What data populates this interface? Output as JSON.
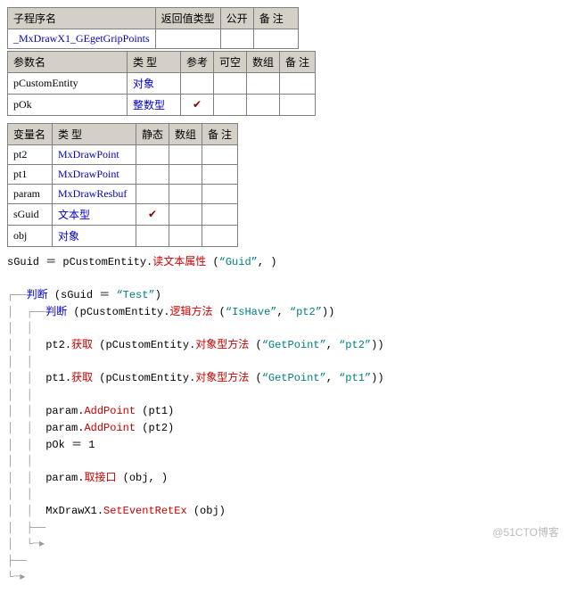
{
  "sub_table": {
    "headers": [
      "子程序名",
      "返回值类型",
      "公开",
      "备 注"
    ],
    "row": {
      "name": "_MxDrawX1_GEgetGripPoints"
    }
  },
  "param_table": {
    "headers": [
      "参数名",
      "类 型",
      "参考",
      "可空",
      "数组",
      "备 注"
    ],
    "rows": [
      {
        "name": "pCustomEntity",
        "type": "对象",
        "ref": ""
      },
      {
        "name": "pOk",
        "type": "整数型",
        "ref": "✔"
      }
    ]
  },
  "var_table": {
    "headers": [
      "变量名",
      "类 型",
      "静态",
      "数组",
      "备 注"
    ],
    "rows": [
      {
        "name": "pt2",
        "type": "MxDrawPoint",
        "static": ""
      },
      {
        "name": "pt1",
        "type": "MxDrawPoint",
        "static": ""
      },
      {
        "name": "param",
        "type": "MxDrawResbuf",
        "static": ""
      },
      {
        "name": "sGuid",
        "type": "文本型",
        "static": "✔"
      },
      {
        "name": "obj",
        "type": "对象",
        "static": ""
      }
    ]
  },
  "code": {
    "l1a": "sGuid ＝ pCustomEntity.",
    "l1b": "读文本属性",
    "l1c": " (",
    "l1d": "“Guid”",
    "l1e": ", )",
    "l2a": "判断",
    "l2b": " (sGuid ＝ ",
    "l2c": "“Test”",
    "l2d": ")",
    "l3a": "判断",
    "l3b": " (pCustomEntity.",
    "l3c": "逻辑方法",
    "l3d": " (",
    "l3e": "“IsHave”",
    "l3f": ", ",
    "l3g": "“pt2”",
    "l3h": "))",
    "l4a": "pt2.",
    "l4b": "获取",
    "l4c": " (pCustomEntity.",
    "l4d": "对象型方法",
    "l4e": " (",
    "l4f": "“GetPoint”",
    "l4g": ", ",
    "l4h": "“pt2”",
    "l4i": "))",
    "l5a": "pt1.",
    "l5b": "获取",
    "l5c": " (pCustomEntity.",
    "l5d": "对象型方法",
    "l5e": " (",
    "l5f": "“GetPoint”",
    "l5g": ", ",
    "l5h": "“pt1”",
    "l5i": "))",
    "l6a": "param.",
    "l6b": "AddPoint",
    "l6c": " (pt1)",
    "l7a": "param.",
    "l7b": "AddPoint",
    "l7c": " (pt2)",
    "l8": "pOk ＝ 1",
    "l9a": "param.",
    "l9b": "取接口",
    "l9c": " (obj, )",
    "l10a": "MxDrawX1.",
    "l10b": "SetEventRetEx",
    "l10c": " (obj)"
  },
  "watermark": "@51CTO博客"
}
